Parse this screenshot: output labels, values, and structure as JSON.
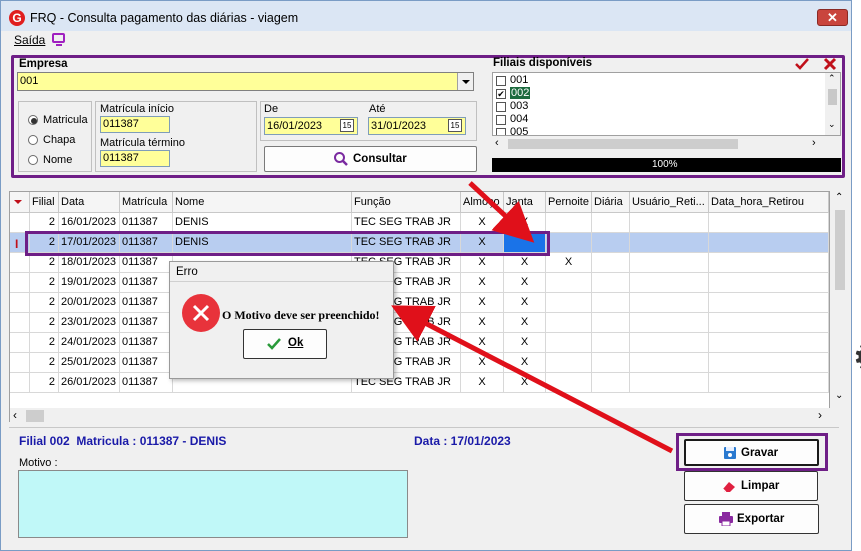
{
  "window": {
    "title": "FRQ - Consulta pagamento das diárias - viagem",
    "close_label": "✕"
  },
  "menu": {
    "saida": "Saída"
  },
  "filter": {
    "empresa_label": "Empresa",
    "empresa_value": "001",
    "radio_options": [
      "Matricula",
      "Chapa",
      "Nome"
    ],
    "radio_selected": "Matricula",
    "matricula_inicio_label": "Matrícula início",
    "matricula_inicio_value": "011387",
    "matricula_termino_label": "Matrícula término",
    "matricula_termino_value": "011387",
    "de_label": "De",
    "de_value": "16/01/2023",
    "ate_label": "Até",
    "ate_value": "31/01/2023",
    "calendar_label": "15",
    "consultar_label": "Consultar"
  },
  "filiais": {
    "label": "Filiais disponíveis",
    "items": [
      {
        "code": "001",
        "checked": false
      },
      {
        "code": "002",
        "checked": true
      },
      {
        "code": "003",
        "checked": false
      },
      {
        "code": "004",
        "checked": false
      },
      {
        "code": "005",
        "checked": false
      }
    ],
    "progress_text": "100%",
    "progress": 1.0
  },
  "grid": {
    "columns": [
      "Filial",
      "Data",
      "Matrícula",
      "Nome",
      "Função",
      "Almoço",
      "Janta",
      "Pernoite",
      "Diária",
      "Usuário_Reti...",
      "Data_hora_Retirou"
    ],
    "rows": [
      {
        "filial": "2",
        "data": "16/01/2023",
        "matricula": "011387",
        "nome": "DENIS",
        "funcao": "TEC SEG TRAB JR",
        "almoco": "X",
        "janta": "X",
        "pernoite": ""
      },
      {
        "filial": "2",
        "data": "17/01/2023",
        "matricula": "011387",
        "nome": "DENIS",
        "funcao": "TEC SEG TRAB JR",
        "almoco": "X",
        "janta": "",
        "pernoite": ""
      },
      {
        "filial": "2",
        "data": "18/01/2023",
        "matricula": "011387",
        "nome": "",
        "funcao": "TEC SEG TRAB JR",
        "almoco": "X",
        "janta": "X",
        "pernoite": "X"
      },
      {
        "filial": "2",
        "data": "19/01/2023",
        "matricula": "011387",
        "nome": "",
        "funcao": "TEC SEG TRAB JR",
        "almoco": "X",
        "janta": "X",
        "pernoite": ""
      },
      {
        "filial": "2",
        "data": "20/01/2023",
        "matricula": "011387",
        "nome": "",
        "funcao": "TEC SEG TRAB JR",
        "almoco": "X",
        "janta": "X",
        "pernoite": ""
      },
      {
        "filial": "2",
        "data": "23/01/2023",
        "matricula": "011387",
        "nome": "",
        "funcao": "TEC SEG TRAB JR",
        "almoco": "X",
        "janta": "X",
        "pernoite": ""
      },
      {
        "filial": "2",
        "data": "24/01/2023",
        "matricula": "011387",
        "nome": "",
        "funcao": "TEC SEG TRAB JR",
        "almoco": "X",
        "janta": "X",
        "pernoite": ""
      },
      {
        "filial": "2",
        "data": "25/01/2023",
        "matricula": "011387",
        "nome": "",
        "funcao": "TEC SEG TRAB JR",
        "almoco": "X",
        "janta": "X",
        "pernoite": ""
      },
      {
        "filial": "2",
        "data": "26/01/2023",
        "matricula": "011387",
        "nome": "",
        "funcao": "TEC SEG TRAB JR",
        "almoco": "X",
        "janta": "X",
        "pernoite": ""
      }
    ],
    "row_marker": "I"
  },
  "dialog": {
    "title": "Erro",
    "message": "O Motivo deve ser preenchido!",
    "ok_label": "Ok"
  },
  "bottom": {
    "info_left": "Filial 002  Matricula : 011387 - DENIS",
    "info_right": "Data : 17/01/2023",
    "motivo_label": "Motivo :",
    "motivo_value": "",
    "gravar_label": "Gravar",
    "limpar_label": "Limpar",
    "exportar_label": "Exportar"
  },
  "colors": {
    "accent_purple": "#6e1e86",
    "arrow_red": "#e0101a",
    "selected_row": "#b8cdf0",
    "selected_cell": "#1a73e8",
    "input_yellow": "#ffff99",
    "motivo_teal": "#c0f8f8"
  }
}
